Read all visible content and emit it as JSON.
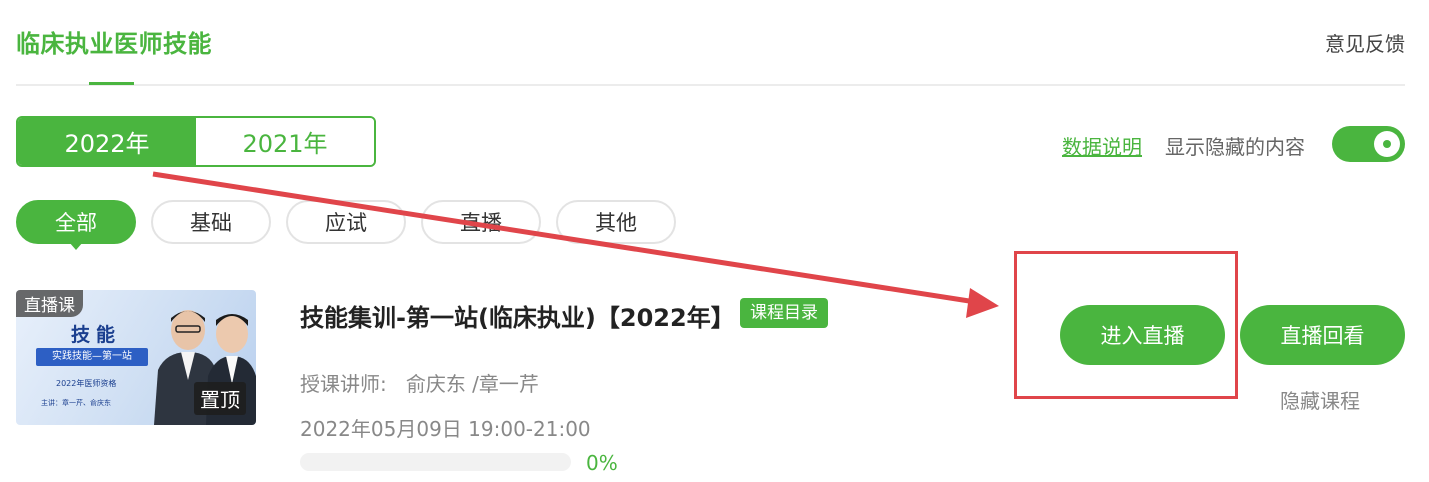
{
  "header": {
    "title": "临床执业医师技能",
    "feedback": "意见反馈"
  },
  "year_tabs": [
    {
      "label": "2022年",
      "active": true
    },
    {
      "label": "2021年",
      "active": false
    }
  ],
  "controls": {
    "data_explain": "数据说明",
    "show_hidden_label": "显示隐藏的内容",
    "show_hidden_on": true
  },
  "filters": [
    {
      "label": "全部",
      "active": true
    },
    {
      "label": "基础",
      "active": false
    },
    {
      "label": "应试",
      "active": false
    },
    {
      "label": "直播",
      "active": false
    },
    {
      "label": "其他",
      "active": false
    }
  ],
  "course": {
    "thumb_badge": "直播课",
    "thumb_title": "技能",
    "thumb_banner": "实践技能—第一站",
    "thumb_subtitle": "2022年医师资格",
    "thumb_lecturers": "主讲：章一芹、俞庆东",
    "pin_label": "置顶",
    "title": "技能集训-第一站(临床执业)【2022年】",
    "catalog_label": "课程目录",
    "teacher_label": "授课讲师:",
    "teachers": "俞庆东 /章一芹",
    "schedule": "2022年05月09日 19:00-21:00",
    "progress": 0,
    "progress_text": "0%",
    "enter_live": "进入直播",
    "replay": "直播回看",
    "hide_course": "隐藏课程"
  },
  "colors": {
    "accent": "#4ab53f",
    "annotation": "#e0454a"
  }
}
